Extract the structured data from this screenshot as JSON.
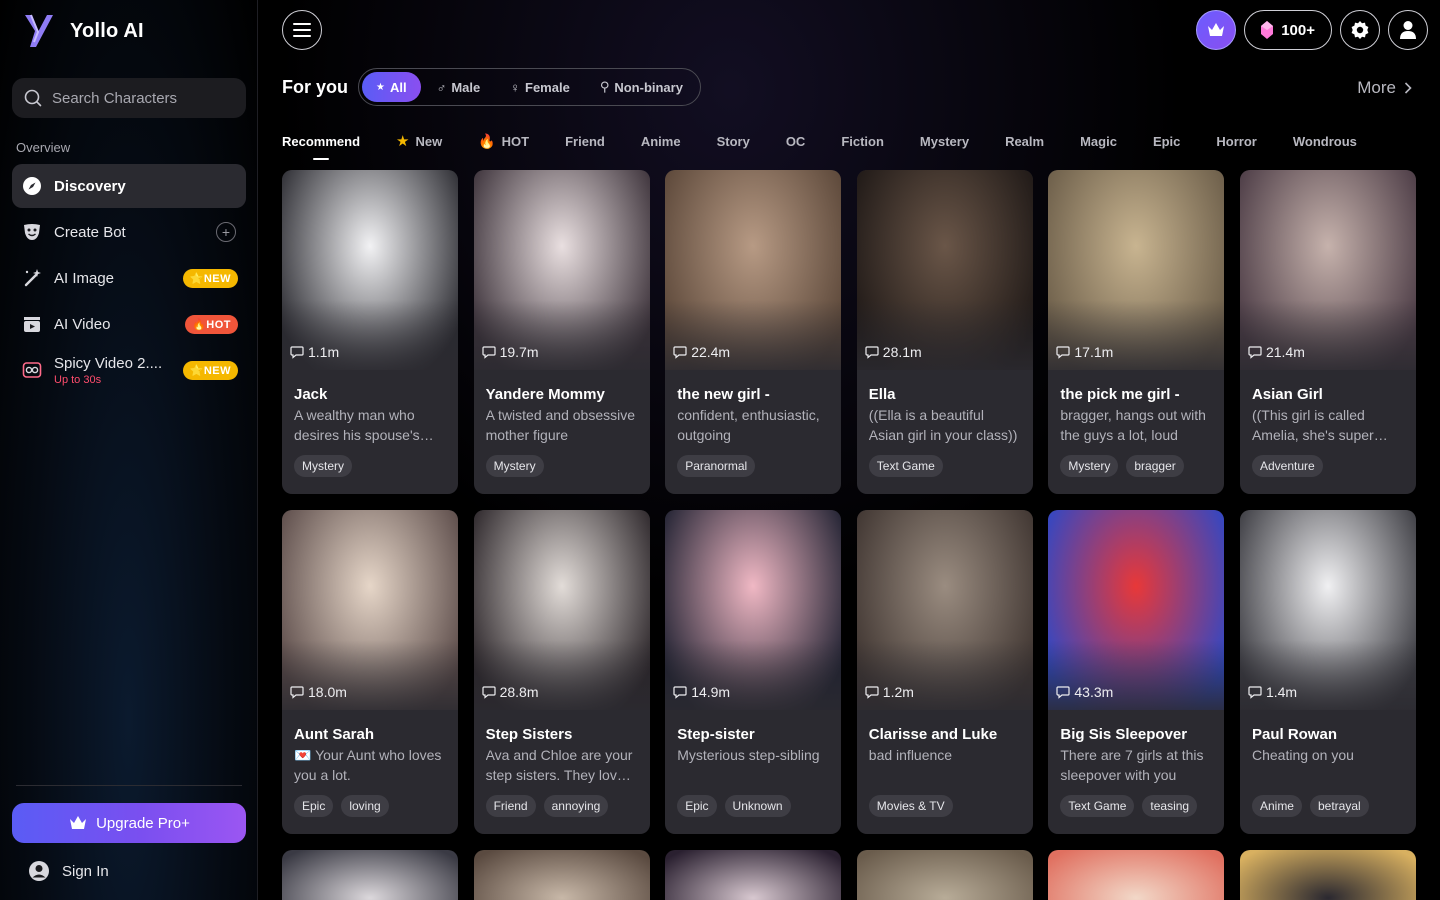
{
  "app": {
    "name": "Yollo AI"
  },
  "search": {
    "placeholder": "Search Characters"
  },
  "sidebar": {
    "section": "Overview",
    "items": [
      {
        "label": "Discovery",
        "icon": "compass-icon"
      },
      {
        "label": "Create Bot",
        "icon": "mask-icon"
      },
      {
        "label": "AI Image",
        "icon": "magic-wand-icon",
        "badge": "NEW"
      },
      {
        "label": "AI Video",
        "icon": "clapperboard-icon",
        "badge": "HOT"
      },
      {
        "label": "Spicy Video 2....",
        "sub": "Up to 30s",
        "icon": "spicy-video-icon",
        "badge": "NEW"
      }
    ],
    "upgrade": "Upgrade Pro+",
    "signin": "Sign In"
  },
  "header": {
    "gems": "100+"
  },
  "filters": {
    "title": "For you",
    "genders": [
      "All",
      "Male",
      "Female",
      "Non-binary"
    ],
    "more": "More"
  },
  "tabs": [
    "Recommend",
    "New",
    "HOT",
    "Friend",
    "Anime",
    "Story",
    "OC",
    "Fiction",
    "Mystery",
    "Realm",
    "Magic",
    "Epic",
    "Horror",
    "Wondrous"
  ],
  "colors": {
    "accent": "#6b5cff",
    "new_badge": "#f5b800",
    "hot_badge": "#f0553a",
    "card_bg": "#2b2a30"
  },
  "cards": [
    {
      "count": "1.1m",
      "name": "Jack",
      "desc": "A wealthy man who desires his spouse's affection",
      "tags": [
        "Mystery"
      ],
      "tone": [
        "#f2f2f4",
        "#2a2a30"
      ]
    },
    {
      "count": "19.7m",
      "name": "Yandere Mommy",
      "desc": "A twisted and obsessive mother figure",
      "tags": [
        "Mystery"
      ],
      "tone": [
        "#e9dfe0",
        "#3a3038"
      ]
    },
    {
      "count": "22.4m",
      "name": "the new girl -",
      "desc": "confident, enthusiastic, outgoing",
      "tags": [
        "Paranormal"
      ],
      "tone": [
        "#b79a84",
        "#5a4638"
      ]
    },
    {
      "count": "28.1m",
      "name": "Ella",
      "desc": "((Ella is a beautiful Asian girl in your class))",
      "tags": [
        "Text Game"
      ],
      "tone": [
        "#6a5648",
        "#1e1816"
      ]
    },
    {
      "count": "17.1m",
      "name": "the pick me girl -",
      "desc": "bragger, hangs out with the guys a lot, loud",
      "tags": [
        "Mystery",
        "bragger"
      ],
      "tone": [
        "#c8b490",
        "#6a5c48"
      ]
    },
    {
      "count": "21.4m",
      "name": "Asian Girl",
      "desc": "((This girl is called Amelia, she's super cute))",
      "tags": [
        "Adventure"
      ],
      "tone": [
        "#c6b2ac",
        "#4a3a44"
      ]
    },
    {
      "count": "18.0m",
      "name": "Aunt Sarah",
      "desc": "💌 Your Aunt who loves you a lot.",
      "tags": [
        "Epic",
        "loving"
      ],
      "tone": [
        "#e6d6c8",
        "#5a4a48"
      ]
    },
    {
      "count": "28.8m",
      "name": "Step Sisters",
      "desc": "Ava and Chloe are your step sisters. They love you",
      "tags": [
        "Friend",
        "annoying"
      ],
      "tone": [
        "#e2dcd8",
        "#2a2428"
      ]
    },
    {
      "count": "14.9m",
      "name": "Step-sister",
      "desc": "Mysterious step-sibling",
      "tags": [
        "Epic",
        "Unknown"
      ],
      "tone": [
        "#f0b8c4",
        "#1e2030"
      ]
    },
    {
      "count": "1.2m",
      "name": "Clarisse and Luke",
      "desc": "bad influence",
      "tags": [
        "Movies & TV"
      ],
      "tone": [
        "#9a8c80",
        "#3e3430"
      ]
    },
    {
      "count": "43.3m",
      "name": "Big Sis Sleepover",
      "desc": "There are 7 girls at this sleepover with you",
      "tags": [
        "Text Game",
        "teasing"
      ],
      "tone": [
        "#e83838",
        "#2c48c8"
      ]
    },
    {
      "count": "1.4m",
      "name": "Paul Rowan",
      "desc": "Cheating on you",
      "tags": [
        "Anime",
        "betrayal"
      ],
      "tone": [
        "#f0f0f2",
        "#3a3a40"
      ]
    }
  ],
  "peek_cards": [
    {
      "tone": [
        "#dcd8dc",
        "#3a3a44"
      ]
    },
    {
      "tone": [
        "#c8b8a8",
        "#5a4a40"
      ]
    },
    {
      "tone": [
        "#d8c8d0",
        "#2a2030"
      ]
    },
    {
      "tone": [
        "#b8ac98",
        "#6a5c4c"
      ]
    },
    {
      "tone": [
        "#f2d8c8",
        "#e07060"
      ]
    },
    {
      "tone": [
        "#2a2830",
        "#d8b060"
      ]
    }
  ]
}
